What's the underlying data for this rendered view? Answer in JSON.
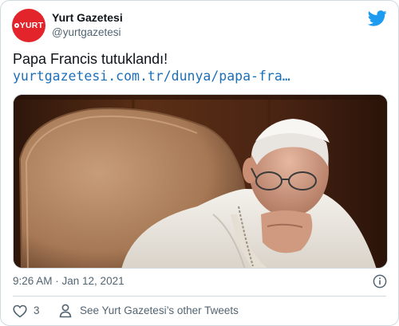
{
  "author": {
    "avatar_text": "YURT",
    "name": "Yurt Gazetesi",
    "handle": "@yurtgazetesi"
  },
  "tweet": {
    "text": "Papa Francis tutuklandı!",
    "link": "yurtgazetesi.com.tr/dunya/papa-fra…"
  },
  "meta": {
    "timestamp": "9:26 AM · Jan 12, 2021"
  },
  "actions": {
    "likes": "3",
    "other_tweets_label": "See Yurt Gazetesi’s other Tweets"
  },
  "icons": {
    "brand": "twitter-bird-icon",
    "info": "info-icon",
    "like": "heart-icon",
    "profile": "profile-icon"
  },
  "colors": {
    "twitter_blue": "#1d9bf0",
    "link": "#1d6fb8",
    "avatar_red": "#e3242b",
    "secondary_text": "#536471",
    "border": "#cfd9de"
  }
}
